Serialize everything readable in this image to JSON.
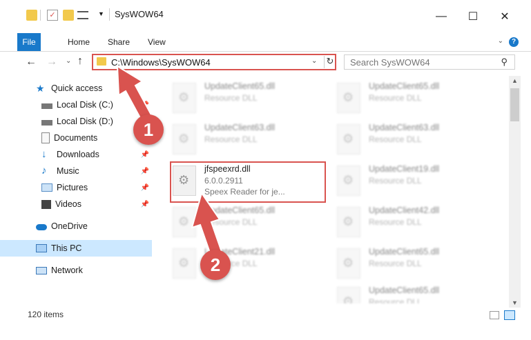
{
  "window": {
    "title": "SysWOW64",
    "minimize": "—",
    "maximize": "☐",
    "close": "✕"
  },
  "ribbon": {
    "tabs": [
      {
        "label": "File"
      },
      {
        "label": "Home"
      },
      {
        "label": "Share"
      },
      {
        "label": "View"
      }
    ],
    "help": "?"
  },
  "address": {
    "path": "C:\\Windows\\SysWOW64",
    "search_placeholder": "Search SysWOW64"
  },
  "sidebar": {
    "items": [
      {
        "label": "Quick access",
        "icon": "star-icon",
        "pinned": false
      },
      {
        "label": "Local Disk (C:)",
        "icon": "drive-icon",
        "pinned": true
      },
      {
        "label": "Local Disk (D:)",
        "icon": "drive-icon",
        "pinned": true
      },
      {
        "label": "Documents",
        "icon": "documents-icon",
        "pinned": true
      },
      {
        "label": "Downloads",
        "icon": "download-icon",
        "pinned": true
      },
      {
        "label": "Music",
        "icon": "music-icon",
        "pinned": true
      },
      {
        "label": "Pictures",
        "icon": "pictures-icon",
        "pinned": true
      },
      {
        "label": "Videos",
        "icon": "videos-icon",
        "pinned": true
      },
      {
        "label": "OneDrive",
        "icon": "cloud-icon",
        "pinned": false
      },
      {
        "label": "This PC",
        "icon": "computer-icon",
        "pinned": false
      },
      {
        "label": "Network",
        "icon": "network-icon",
        "pinned": false
      }
    ]
  },
  "files": {
    "left": [
      {
        "name": "UpdateClient65.dll",
        "sub": "Resource DLL",
        "sub2": ""
      },
      {
        "name": "UpdateClient63.dll",
        "sub": "Resource DLL",
        "sub2": ""
      },
      {
        "name": "jfspeexrd.dll",
        "sub": "6.0.0.2911",
        "sub2": "Speex Reader for je..."
      },
      {
        "name": "UpdateClient65.dll",
        "sub": "Resource DLL",
        "sub2": ""
      },
      {
        "name": "UpdateClient21.dll",
        "sub": "Resource DLL",
        "sub2": ""
      }
    ],
    "right": [
      {
        "name": "UpdateClient65.dll",
        "sub": "Resource DLL"
      },
      {
        "name": "UpdateClient63.dll",
        "sub": "Resource DLL"
      },
      {
        "name": "UpdateClient19.dll",
        "sub": "Resource DLL"
      },
      {
        "name": "UpdateClient42.dll",
        "sub": "Resource DLL"
      },
      {
        "name": "UpdateClient65.dll",
        "sub": "Resource DLL"
      },
      {
        "name": "UpdateClient65.dll",
        "sub": "Resource DLL"
      }
    ]
  },
  "status": {
    "item_count": "120 items"
  },
  "annotations": {
    "step1": "1",
    "step2": "2",
    "color": "#d9534f"
  }
}
